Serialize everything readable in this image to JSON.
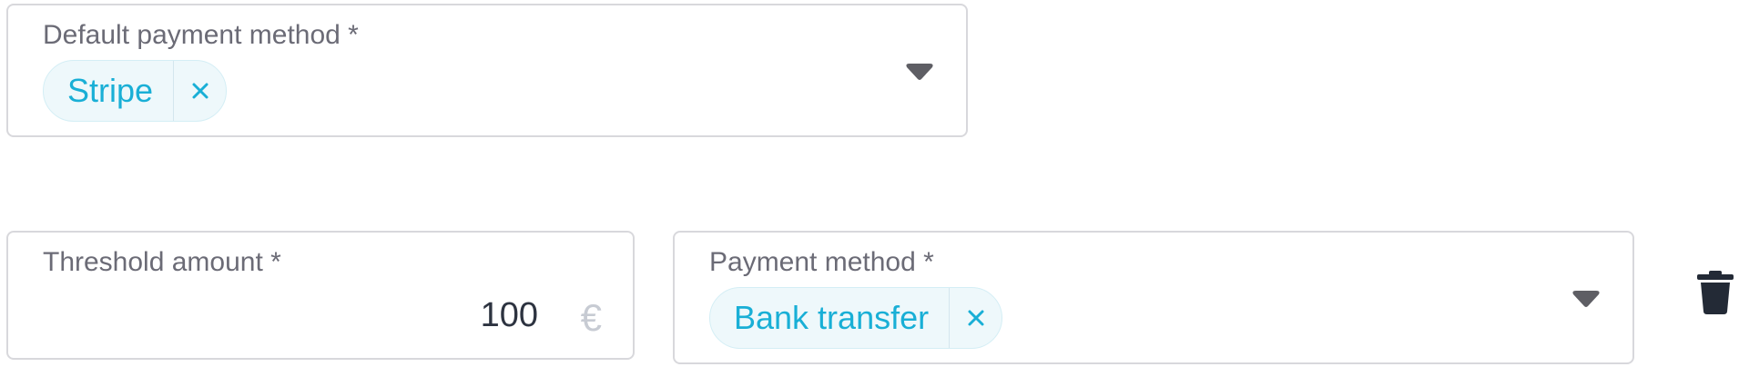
{
  "default_payment": {
    "label": "Default payment method *",
    "selected": "Stripe",
    "remove_symbol": "×"
  },
  "threshold": {
    "label": "Threshold amount *",
    "value": "100",
    "currency": "€"
  },
  "payment_method": {
    "label": "Payment method *",
    "selected": "Bank transfer",
    "remove_symbol": "×"
  },
  "icons": {
    "dropdown": "caret-down-icon",
    "remove": "close-icon",
    "delete": "trash-icon"
  },
  "colors": {
    "chip_text": "#19afd6",
    "chip_bg": "#eef8fb",
    "border": "#d8d8dc",
    "label": "#6b6b76",
    "trash": "#232a36"
  }
}
